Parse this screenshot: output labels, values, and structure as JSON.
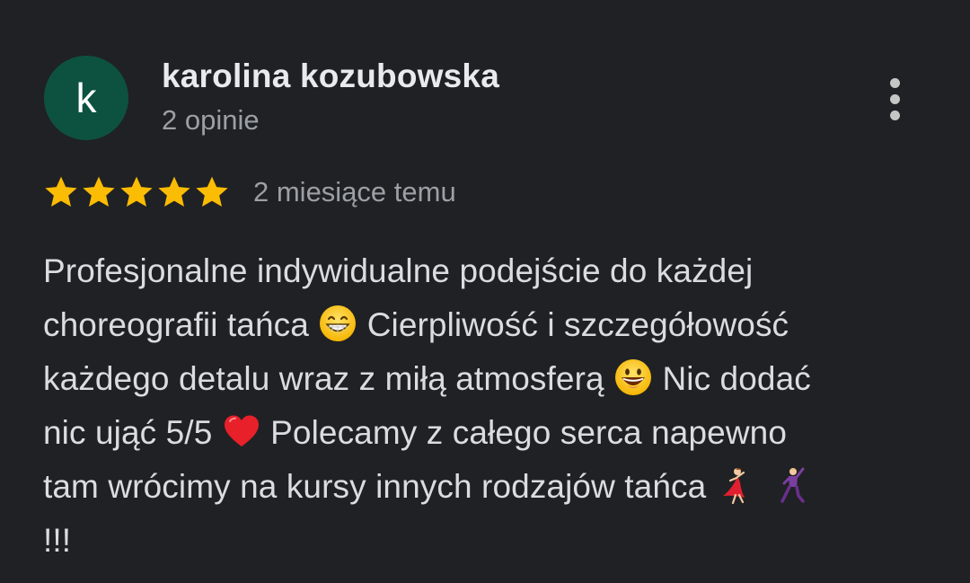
{
  "review": {
    "author": {
      "initial": "k",
      "name": "karolina kozubowska",
      "reviews_count": "2 opinie",
      "avatar_color": "#0d5240"
    },
    "rating": 5,
    "max_rating": 5,
    "star_color": "#fbbc04",
    "date": "2 miesiące temu",
    "text_segments": {
      "s1": "Profesjonalne indywidualne podejście do każdej",
      "s2": "choreografii tańca ",
      "s3": " Cierpliwość i szczegółowość",
      "s4": "każdego detalu wraz z miłą atmosferą ",
      "s5": " Nic dodać",
      "s6": "nic ująć 5/5 ",
      "s7": " Polecamy z całego serca napewno",
      "s8": "tam wrócimy na kursy innych rodzajów tańca ",
      "s9": "!!!"
    },
    "emojis": [
      "grinning-face-with-smiling-eyes-emoji",
      "grinning-face-emoji",
      "red-heart-emoji",
      "dancing-woman-emoji",
      "dancing-man-emoji"
    ]
  },
  "more_menu": {
    "icon": "more-vert-icon"
  }
}
